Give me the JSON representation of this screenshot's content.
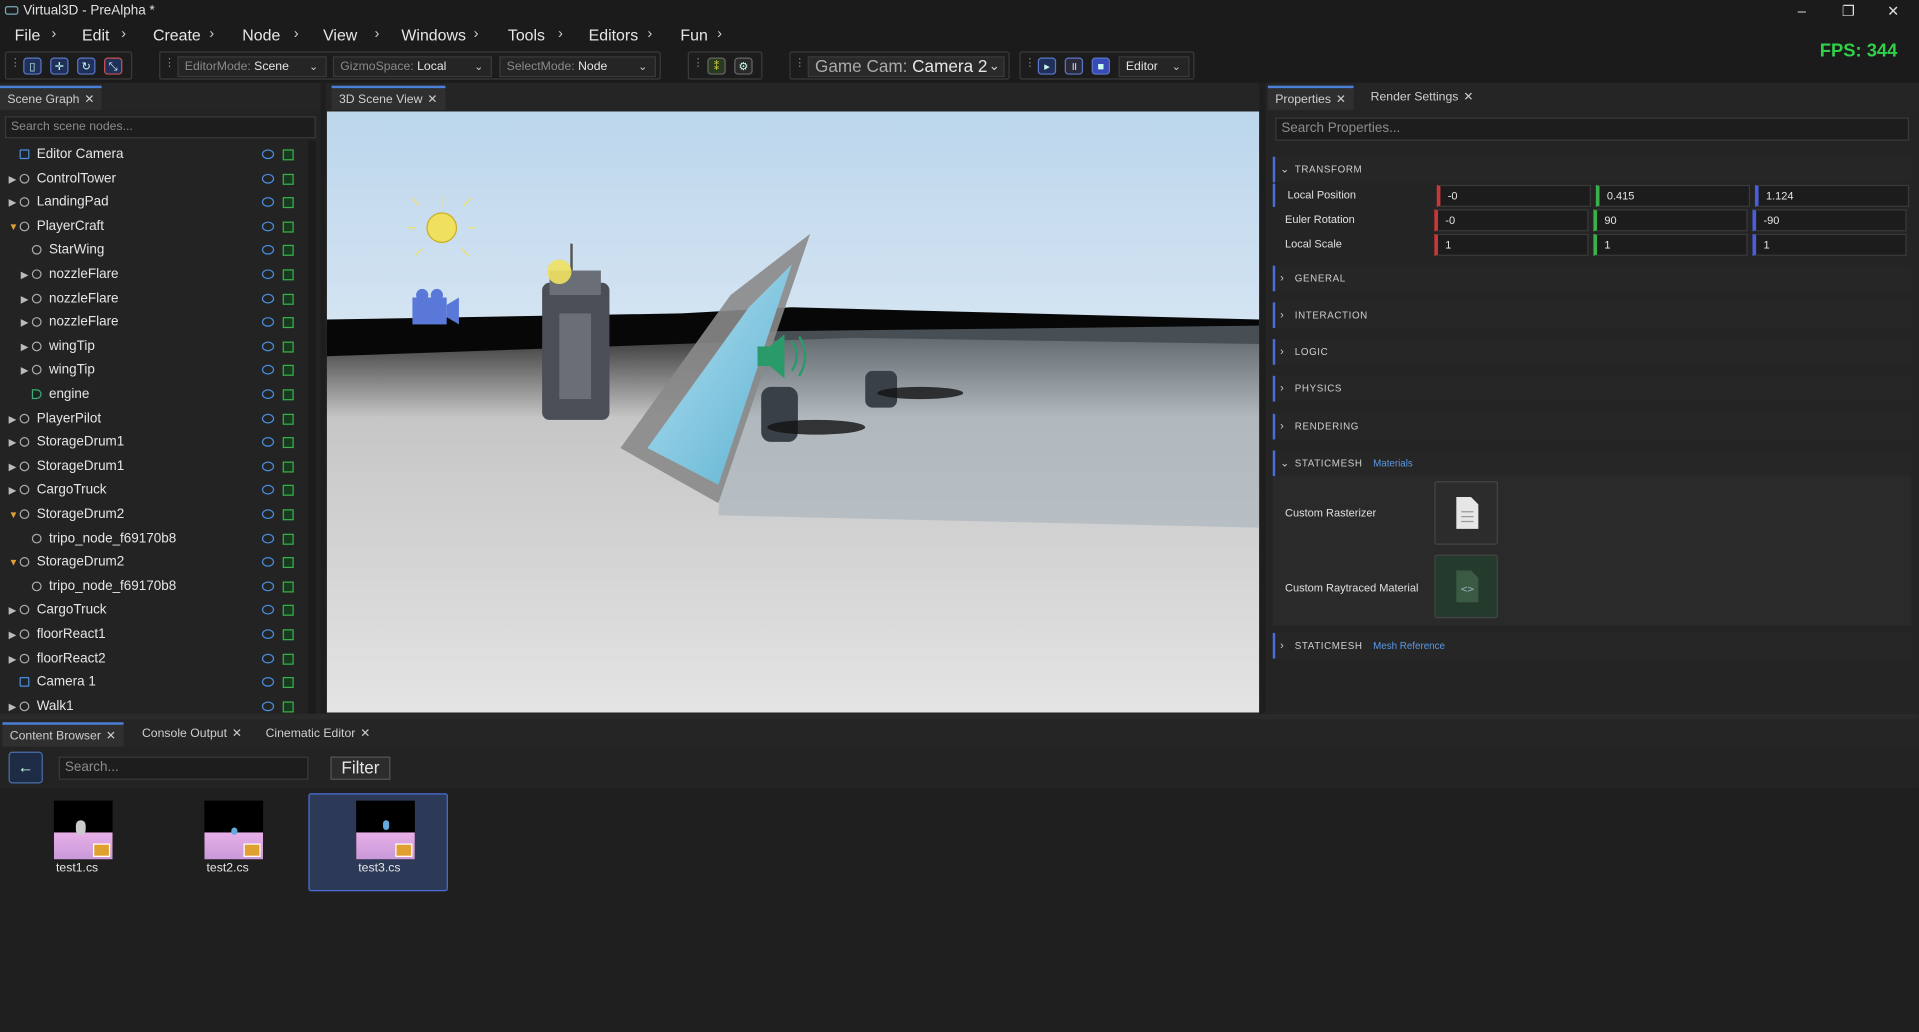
{
  "window": {
    "title": "Virtual3D - PreAlpha *",
    "minimize": "–",
    "maximize": "❐",
    "close": "✕"
  },
  "menu": [
    "File",
    "Edit",
    "Create",
    "Node",
    "View",
    "Windows",
    "Tools",
    "Editors",
    "Fun"
  ],
  "toolbar": {
    "editor_mode_label": "EditorMode:",
    "editor_mode_value": "Scene",
    "gizmo_space_label": "GizmoSpace:",
    "gizmo_space_value": "Local",
    "select_mode_label": "SelectMode:",
    "select_mode_value": "Node",
    "game_cam_label": "Game Cam:",
    "game_cam_value": "Camera 2",
    "play_mode_value": "Editor"
  },
  "fps": "FPS: 344",
  "scene_graph": {
    "tab": "Scene Graph",
    "search_placeholder": "Search scene nodes...",
    "nodes": [
      {
        "label": "Editor Camera",
        "depth": 0,
        "arrow": "",
        "icon": "camera-icon"
      },
      {
        "label": "ControlTower",
        "depth": 0,
        "arrow": "closed",
        "icon": "node-icon"
      },
      {
        "label": "LandingPad",
        "depth": 0,
        "arrow": "closed",
        "icon": "node-icon"
      },
      {
        "label": "PlayerCraft",
        "depth": 0,
        "arrow": "open",
        "icon": "node-icon"
      },
      {
        "label": "StarWing",
        "depth": 1,
        "arrow": "",
        "icon": "node-icon"
      },
      {
        "label": "nozzleFlare",
        "depth": 1,
        "arrow": "closed",
        "icon": "node-icon"
      },
      {
        "label": "nozzleFlare",
        "depth": 1,
        "arrow": "closed",
        "icon": "node-icon"
      },
      {
        "label": "nozzleFlare",
        "depth": 1,
        "arrow": "closed",
        "icon": "node-icon"
      },
      {
        "label": "wingTip",
        "depth": 1,
        "arrow": "closed",
        "icon": "node-icon"
      },
      {
        "label": "wingTip",
        "depth": 1,
        "arrow": "closed",
        "icon": "node-icon"
      },
      {
        "label": "engine",
        "depth": 1,
        "arrow": "",
        "icon": "speaker-icon"
      },
      {
        "label": "PlayerPilot",
        "depth": 0,
        "arrow": "closed",
        "icon": "node-icon"
      },
      {
        "label": "StorageDrum1",
        "depth": 0,
        "arrow": "closed",
        "icon": "node-icon"
      },
      {
        "label": "StorageDrum1",
        "depth": 0,
        "arrow": "closed",
        "icon": "node-icon"
      },
      {
        "label": "CargoTruck",
        "depth": 0,
        "arrow": "closed",
        "icon": "node-icon"
      },
      {
        "label": "StorageDrum2",
        "depth": 0,
        "arrow": "open",
        "icon": "node-icon"
      },
      {
        "label": "tripo_node_f69170b8",
        "depth": 1,
        "arrow": "",
        "icon": "node-icon"
      },
      {
        "label": "StorageDrum2",
        "depth": 0,
        "arrow": "open",
        "icon": "node-icon"
      },
      {
        "label": "tripo_node_f69170b8",
        "depth": 1,
        "arrow": "",
        "icon": "node-icon"
      },
      {
        "label": "CargoTruck",
        "depth": 0,
        "arrow": "closed",
        "icon": "node-icon"
      },
      {
        "label": "floorReact1",
        "depth": 0,
        "arrow": "closed",
        "icon": "node-icon"
      },
      {
        "label": "floorReact2",
        "depth": 0,
        "arrow": "closed",
        "icon": "node-icon"
      },
      {
        "label": "Camera 1",
        "depth": 0,
        "arrow": "",
        "icon": "camera-icon"
      },
      {
        "label": "Walk1",
        "depth": 0,
        "arrow": "closed",
        "icon": "node-icon"
      }
    ]
  },
  "scene_view": {
    "tab": "3D Scene View"
  },
  "properties": {
    "tabs": [
      "Properties",
      "Render Settings"
    ],
    "search_placeholder": "Search Properties...",
    "transform_title": "TRANSFORM",
    "transform_rows": [
      {
        "label": "Local Position",
        "x": "-0",
        "y": "0.415",
        "z": "1.124"
      },
      {
        "label": "Euler Rotation",
        "x": "-0",
        "y": "90",
        "z": "-90"
      },
      {
        "label": "Local Scale",
        "x": "1",
        "y": "1",
        "z": "1"
      }
    ],
    "sections": [
      "GENERAL",
      "INTERACTION",
      "LOGIC",
      "PHYSICS",
      "RENDERING"
    ],
    "staticmesh_title": "STATICMESH",
    "materials_sub": "Materials",
    "custom_rasterizer": "Custom Rasterizer",
    "custom_raytraced": "Custom Raytraced Material",
    "mesh_reference_sub": "Mesh Reference"
  },
  "bottom": {
    "tabs": [
      "Content Browser",
      "Console Output",
      "Cinematic Editor"
    ],
    "search_placeholder": "Search...",
    "filter_label": "Filter",
    "assets": [
      "test1.cs",
      "test2.cs",
      "test3.cs"
    ]
  },
  "colors": {
    "accent": "#4a80d8",
    "fps": "#2fd04a",
    "axis_x": "#c83838",
    "axis_y": "#3ab04a",
    "axis_z": "#4a5ed8",
    "folder": "#e0a030"
  }
}
